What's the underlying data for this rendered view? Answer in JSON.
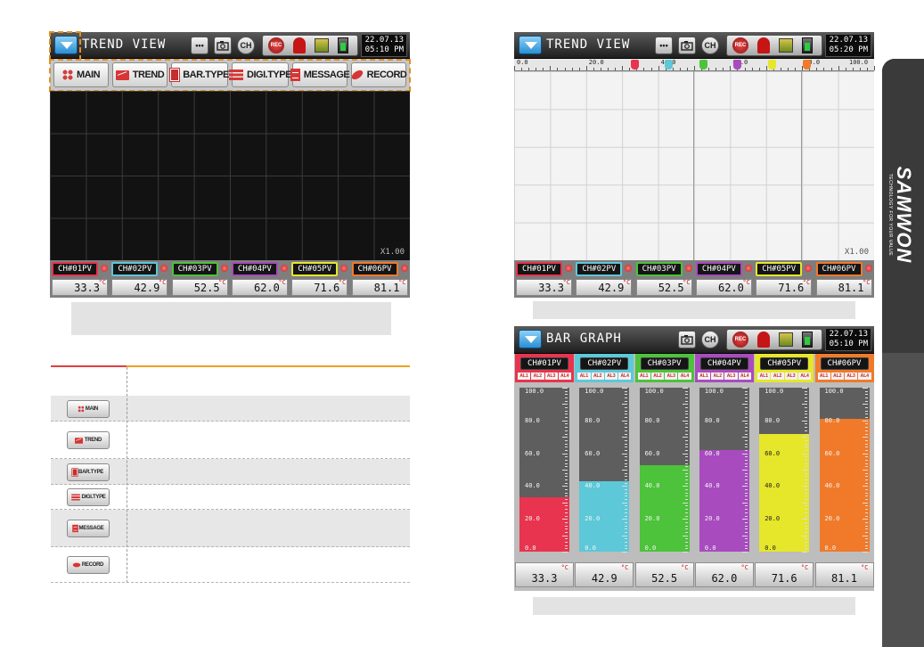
{
  "trend_screen_left": {
    "title": "TREND VIEW",
    "icons": {
      "more_label": "•••",
      "rec_label": "REC",
      "ch_label": "CH"
    },
    "datetime": {
      "date": "22.07.13",
      "time": "05:10 PM"
    },
    "nav_buttons": [
      {
        "label": "MAIN",
        "icon": "main-icon"
      },
      {
        "label": "TREND",
        "icon": "trend-icon"
      },
      {
        "label": "BAR.TYPE",
        "icon": "bar-type-icon"
      },
      {
        "label": "DIGI.TYPE",
        "icon": "digi-type-icon"
      },
      {
        "label": "MESSAGE",
        "icon": "message-icon"
      },
      {
        "label": "RECORD",
        "icon": "record-icon"
      }
    ],
    "zoom": "X1.00"
  },
  "trend_screen_right": {
    "title": "TREND VIEW",
    "datetime": {
      "date": "22.07.13",
      "time": "05:20 PM"
    },
    "ruler_labels": [
      "0.0",
      "20.0",
      "40.0",
      "60.0",
      "80.0",
      "100.0"
    ],
    "zoom": "X1.00"
  },
  "channels": [
    {
      "tag": "CH#01PV",
      "value": "33.3",
      "unit": "°C",
      "color": "#e8344e"
    },
    {
      "tag": "CH#02PV",
      "value": "42.9",
      "unit": "°C",
      "color": "#5cc8d8"
    },
    {
      "tag": "CH#03PV",
      "value": "52.5",
      "unit": "°C",
      "color": "#4cc33a"
    },
    {
      "tag": "CH#04PV",
      "value": "62.0",
      "unit": "°C",
      "color": "#a84bbf"
    },
    {
      "tag": "CH#05PV",
      "value": "71.6",
      "unit": "°C",
      "color": "#e6e62a"
    },
    {
      "tag": "CH#06PV",
      "value": "81.1",
      "unit": "°C",
      "color": "#f07a2a"
    }
  ],
  "bar_graph_screen": {
    "title": "BAR GRAPH",
    "datetime": {
      "date": "22.07.13",
      "time": "05:10 PM"
    },
    "alarm_labels": [
      "AL1",
      "AL2",
      "AL3",
      "AL4"
    ],
    "scale_labels": [
      "100.0",
      "80.0",
      "60.0",
      "40.0",
      "20.0",
      "0.0"
    ],
    "bar_range": [
      0,
      100
    ]
  },
  "table": {
    "rows": [
      {
        "button_label": "MAIN",
        "icon": "main-icon",
        "shaded": true
      },
      {
        "button_label": "TREND",
        "icon": "trend-icon",
        "shaded": false
      },
      {
        "button_label": "BAR.TYPE",
        "icon": "bar-type-icon",
        "shaded": true
      },
      {
        "button_label": "DIGI.TYPE",
        "icon": "digi-type-icon",
        "shaded": false
      },
      {
        "button_label": "MESSAGE",
        "icon": "message-icon",
        "shaded": true
      },
      {
        "button_label": "RECORD",
        "icon": "record-icon",
        "shaded": false
      }
    ]
  },
  "brand": {
    "name": "SAMWON",
    "tagline": "TECHNOLOGY FOR YOUR VALUE"
  },
  "colors": {
    "accent_dash": "#e09020",
    "table_red": "#e04040",
    "table_orange": "#f0a020"
  }
}
